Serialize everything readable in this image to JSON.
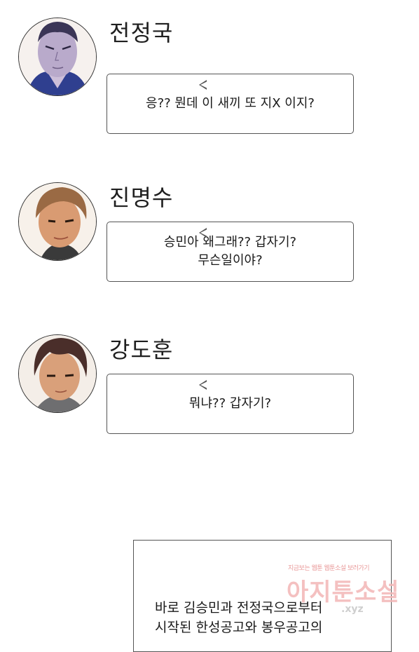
{
  "messages": [
    {
      "name": "전정국",
      "text": "응?? 뭔데 이 새끼 또 지X 이지?"
    },
    {
      "name": "진명수",
      "text": "승민아 왜그래?? 갑자기?\n무슨일이야?"
    },
    {
      "name": "강도훈",
      "text": "뭐냐?? 갑자기?"
    }
  ],
  "narration": {
    "text": "바로 김승민과 전정국으로부터\n시작된 한성공고와 봉우공고의"
  },
  "watermark": {
    "tagline": "지금보는 웹툰 웹툰소설 보러가기",
    "site": "아지툰소설",
    "domain": ".xyz"
  }
}
